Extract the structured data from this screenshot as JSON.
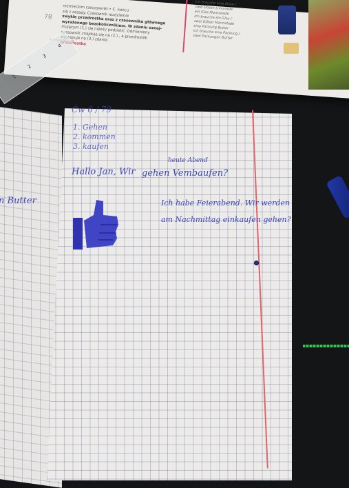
{
  "textbook": {
    "page_number": "78",
    "text_lines": [
      "niemieckim rzeczowniki • C. końcu",
      "się z zasady. Czasownik rozdzielnie",
      "zwykle przedrostka oraz z czasownika głównego",
      "wyrażonego bezokolicznikiem. W zdaniu oznaj-",
      "mującym (1.) się należy podzielić. Odmieniony",
      "czasownik znajduje się na (2.) , a przedrostek",
      "występuje na (3.) zdania."
    ],
    "highlight_word": "przedrostka",
    "right_column": [
      "Ich brauche eine Dose /",
      "zwei Dosen Limonade.",
      "",
      "ein Glas Marmelade",
      "Ich brauche ein Glas /",
      "zwei Gläser Marmelade",
      "",
      "eine Packung Butter",
      "Ich brauche eine Packung /",
      "zwei Packungen Butter"
    ],
    "footer": "schlussteilung"
  },
  "notebook": {
    "left_page_text": "n Butter",
    "header": "Ćw 6 / 79",
    "list": [
      "1. Gehen",
      "2. kommen",
      "3. kaufen"
    ],
    "line1": "Hallo Jan, Wir",
    "line1_insert": "heute Abend",
    "line1_rest": "gehen Vembaufen?",
    "response_line1": "Ich habe Feierabend. Wir werden",
    "response_line2": "am Nachmittag einkaufen gehen?",
    "drawing": "thumbs-up"
  },
  "colors": {
    "ink": "#3b45b8",
    "paper": "#ecebe9",
    "grid": "#6e7d96",
    "margin": "#e2646a",
    "table": "#141516"
  }
}
